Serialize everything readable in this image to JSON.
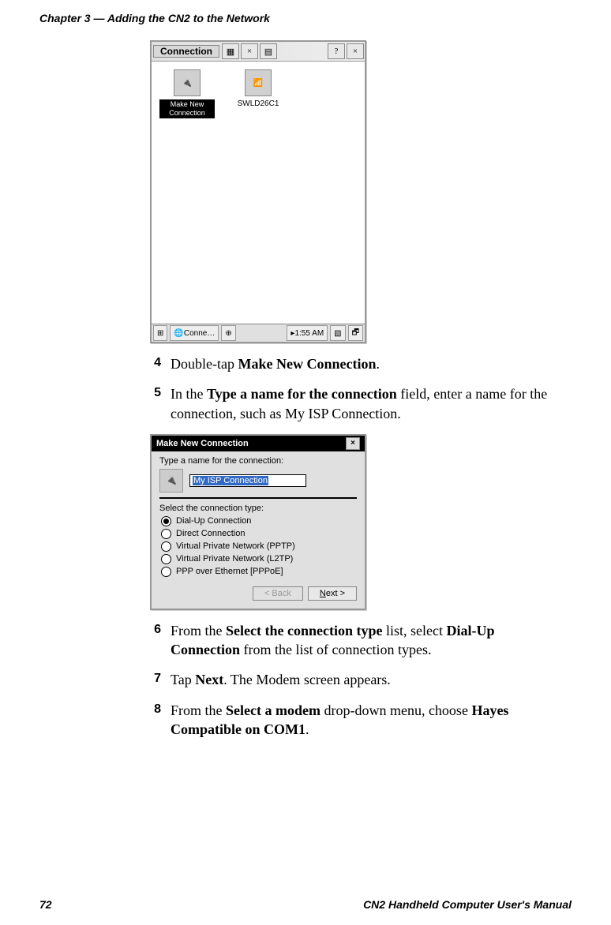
{
  "header": "Chapter 3 — Adding the CN2 to the Network",
  "screenshot1": {
    "title": "Connection",
    "icon1_label_line1": "Make New",
    "icon1_label_line2": "Connection",
    "icon2_label": "SWLD26C1",
    "help_symbol": "?",
    "close_symbol": "×",
    "taskbar_app": "Conne…",
    "taskbar_time": "1:55 AM",
    "taskbar_arrow": "▸"
  },
  "steps": {
    "s4_num": "4",
    "s4_pre": "Double-tap ",
    "s4_bold": "Make New Connection",
    "s4_post": ".",
    "s5_num": "5",
    "s5_pre": "In the ",
    "s5_bold": "Type a name for the connection",
    "s5_post": " field, enter a name for the connection, such as My ISP Connection.",
    "s6_num": "6",
    "s6_pre": "From the ",
    "s6_bold": "Select the connection type",
    "s6_mid": " list, select ",
    "s6_bold2": "Dial-Up Connection",
    "s6_post": " from the list of connection types.",
    "s7_num": "7",
    "s7_pre": "Tap ",
    "s7_bold": "Next",
    "s7_post": ". The Modem screen appears.",
    "s8_num": "8",
    "s8_pre": "From the ",
    "s8_bold": "Select a modem",
    "s8_mid": " drop-down menu, choose ",
    "s8_bold2": "Hayes Compatible on COM1",
    "s8_post": "."
  },
  "screenshot2": {
    "title": "Make New Connection",
    "close_symbol": "×",
    "prompt1": "Type a name for the connection:",
    "input_value": "My ISP Connection",
    "prompt2": "Select the connection type:",
    "options": {
      "o1": "Dial-Up Connection",
      "o2": "Direct Connection",
      "o3": "Virtual Private Network (PPTP)",
      "o4": "Virtual Private Network (L2TP)",
      "o5": "PPP over Ethernet [PPPoE]"
    },
    "back_label": "< Back",
    "next_prefix": "N",
    "next_suffix": "ext >"
  },
  "footer": {
    "page": "72",
    "manual": "CN2 Handheld Computer User's Manual"
  }
}
